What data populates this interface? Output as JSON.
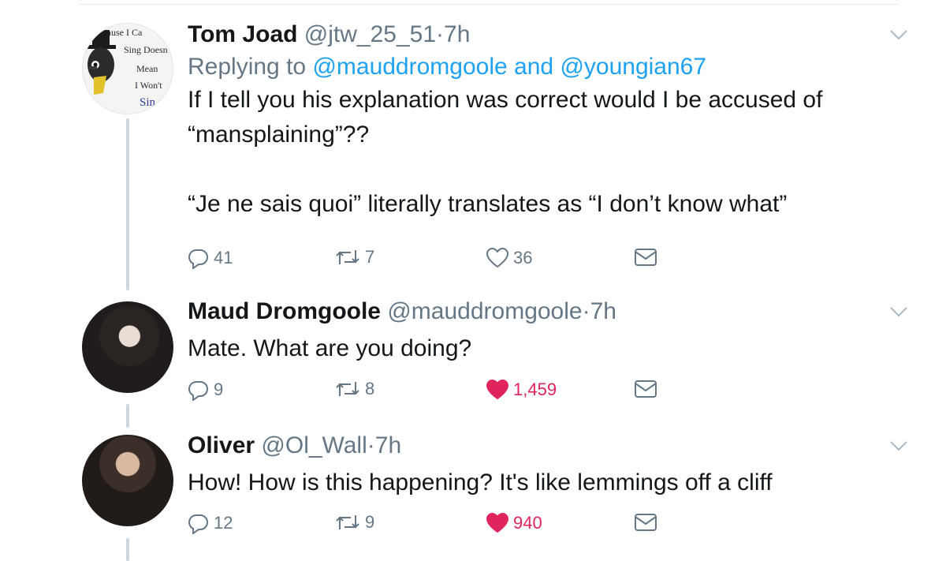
{
  "tweets": [
    {
      "name": "Tom Joad",
      "handle": "@jtw_25_51",
      "separator": "·",
      "time": "7h",
      "reply_prefix": "Replying to",
      "reply_user1": "@mauddromgoole",
      "reply_and": "and",
      "reply_user2": "@youngian67",
      "text": "If I tell you his explanation was correct would I be accused of “mansplaining”??\n\n“Je ne sais quoi” literally translates as “I don’t know what”",
      "replies": "41",
      "retweets": "7",
      "likes": "36",
      "liked": false,
      "avatar_text": [
        "Because I Ca",
        "Sing Doesn",
        "Mean",
        "I Won't",
        "Sin"
      ]
    },
    {
      "name": "Maud Dromgoole",
      "handle": "@mauddromgoole",
      "separator": "·",
      "time": "7h",
      "text": "Mate. What are you doing?",
      "replies": "9",
      "retweets": "8",
      "likes": "1,459",
      "liked": true
    },
    {
      "name": "Oliver",
      "handle": "@Ol_Wall",
      "separator": "·",
      "time": "7h",
      "text": "How! How is this happening? It's like lemmings off a cliff",
      "replies": "12",
      "retweets": "9",
      "likes": "940",
      "liked": true
    }
  ],
  "icons": {
    "reply": "reply-icon",
    "retweet": "retweet-icon",
    "like": "heart-icon",
    "dm": "envelope-icon",
    "more": "chevron-down-icon"
  },
  "colors": {
    "link": "#1da1f2",
    "secondary": "#657786",
    "like_active": "#e0245e",
    "thread_line": "#ccd6dd"
  }
}
